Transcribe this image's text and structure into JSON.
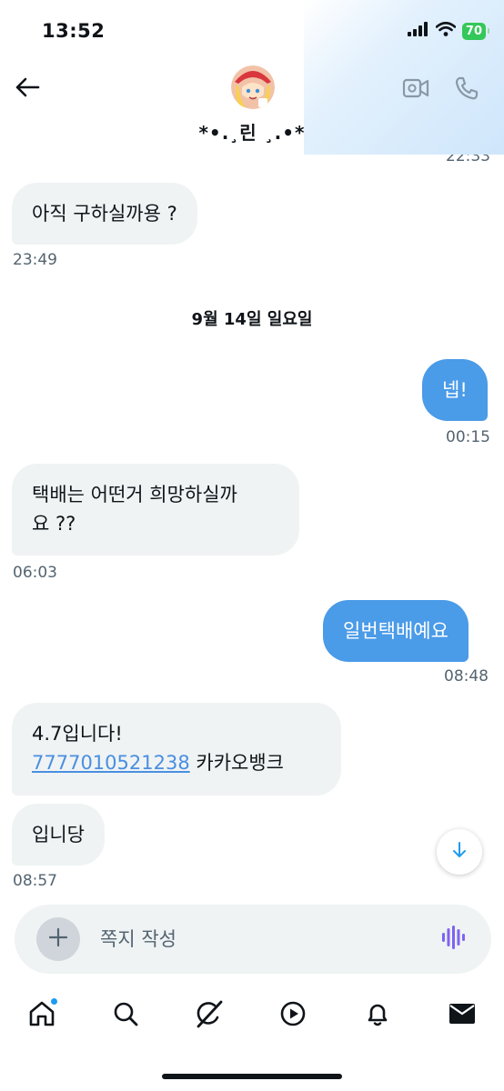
{
  "status_bar": {
    "time": "13:52",
    "battery": "70"
  },
  "header": {
    "contact_name": "*•.¸린 ¸.•*"
  },
  "chat": {
    "prev_time": "22:33",
    "messages": [
      {
        "text": "아직 구하실까용 ?",
        "time": "23:49",
        "direction": "incoming"
      },
      {
        "text": "넵!",
        "time": "00:15",
        "direction": "outgoing"
      },
      {
        "line1": "택배는 어떤거 희망하실까",
        "line2": "요 ??",
        "time": "06:03",
        "direction": "incoming"
      },
      {
        "text": "일번택배예요",
        "time": "08:48",
        "direction": "outgoing"
      },
      {
        "line1": "4.7입니다!",
        "account": "7777010521238",
        "bank": "카카오뱅크",
        "direction": "incoming"
      },
      {
        "text": "입니당",
        "time": "08:57",
        "direction": "incoming"
      }
    ],
    "date_separator": "9월 14일 일요일"
  },
  "composer": {
    "placeholder": "쪽지 작성"
  },
  "colors": {
    "accent": "#1d9bf0",
    "outgoing_bubble": "#4a9be8",
    "incoming_bubble": "#eff3f4",
    "battery": "#34c759",
    "voice": "#7856ff"
  },
  "icons": {
    "back": "arrow-left-icon",
    "video": "video-camera-icon",
    "call": "phone-icon",
    "scroll": "arrow-down-icon",
    "add": "plus-icon",
    "voice": "waveform-icon",
    "tabs": [
      "home-icon",
      "search-icon",
      "grok-icon",
      "video-play-icon",
      "bell-icon",
      "envelope-icon"
    ]
  }
}
